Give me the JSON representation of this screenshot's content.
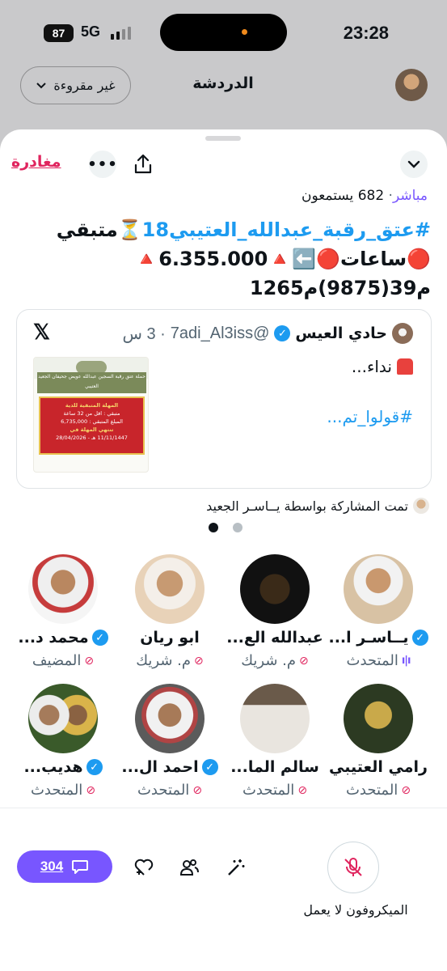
{
  "status_bar": {
    "time": "23:28",
    "battery": "87",
    "network": "5G"
  },
  "background": {
    "title": "الدردشة",
    "unread_filter": "غير مقروءة"
  },
  "space": {
    "leave_label": "مغادرة",
    "live_label": "مباشر",
    "listeners_text": "682 يستمعون",
    "title_hashtag": "#عتق_رقبة_عبدالله_العتيبي18",
    "title_rest": "⏳متبقي 🔴ساعات🔴⬅️🔺6.355.000🔺 م39(9875)م1265"
  },
  "pinned_tweet": {
    "author_name": "حادي العيس",
    "handle": "@7adi_Al3iss",
    "time": "3 س",
    "line1": "نداء...",
    "line2": "#قولوا_تم...",
    "poster": {
      "header": "حملة عتق رقبة السجين عبدالله عويض جحيفان الجعيد العتيبي",
      "heading": "المهلة المتبقية للدية",
      "line1": "متبقي : اقل من 32 ساعة",
      "line2": "المبلغ المتبقي : 6,735,000",
      "line3": "تنتهي المهلة في",
      "line4": "11/11/1447 هـ - 28/04/2026"
    }
  },
  "shared_by": "تمت المشاركة بواسطة يــاسـر الجعيد",
  "speakers": [
    {
      "name": "يــاسـر ا...",
      "role": "المتحدث",
      "verified": true,
      "status": "speaking"
    },
    {
      "name": "عبدالله الع...",
      "role": "م. شريك",
      "verified": false,
      "status": "muted"
    },
    {
      "name": "ابو ريان",
      "role": "م. شريك",
      "verified": false,
      "status": "muted"
    },
    {
      "name": "محمد د...",
      "role": "المضيف",
      "verified": true,
      "status": "muted"
    },
    {
      "name": "رامي العتيبي",
      "role": "المتحدث",
      "verified": false,
      "status": "muted"
    },
    {
      "name": "سالم الما...",
      "role": "المتحدث",
      "verified": false,
      "status": "muted"
    },
    {
      "name": "احمد ال...",
      "role": "المتحدث",
      "verified": true,
      "status": "muted"
    },
    {
      "name": "هديب...",
      "role": "المتحدث",
      "verified": true,
      "status": "muted"
    }
  ],
  "bottom_bar": {
    "comments_count": "304",
    "mic_label": "الميكروفون لا يعمل"
  },
  "colors": {
    "accent": "#7856ff",
    "link": "#1d9bf0",
    "leave": "#e0245e"
  },
  "icons": [
    "chevron-down-icon",
    "share-icon",
    "more-icon",
    "x-logo-icon",
    "verified-icon",
    "mic-off-icon",
    "comment-icon",
    "heart-plus-icon",
    "people-icon",
    "magic-wand-icon"
  ]
}
